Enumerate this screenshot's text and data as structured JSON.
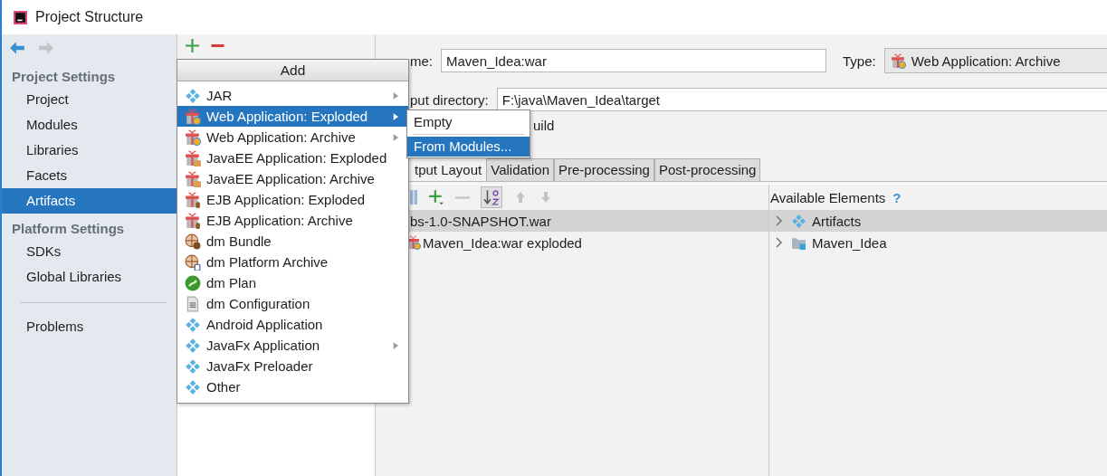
{
  "window": {
    "title": "Project Structure"
  },
  "sidebar": {
    "sections": [
      {
        "heading": "Project Settings",
        "items": [
          {
            "label": "Project",
            "selected": false
          },
          {
            "label": "Modules",
            "selected": false
          },
          {
            "label": "Libraries",
            "selected": false
          },
          {
            "label": "Facets",
            "selected": false
          },
          {
            "label": "Artifacts",
            "selected": true
          }
        ]
      },
      {
        "heading": "Platform Settings",
        "items": [
          {
            "label": "SDKs",
            "selected": false
          },
          {
            "label": "Global Libraries",
            "selected": false
          }
        ]
      }
    ],
    "footer_items": [
      {
        "label": "Problems",
        "selected": false
      }
    ]
  },
  "add_menu": {
    "title": "Add",
    "items": [
      {
        "label": "JAR",
        "kind": "diamond",
        "has_submenu": true,
        "selected": false
      },
      {
        "label": "Web Application: Exploded",
        "kind": "gift-web",
        "has_submenu": true,
        "selected": true
      },
      {
        "label": "Web Application: Archive",
        "kind": "gift-web",
        "has_submenu": true,
        "selected": false
      },
      {
        "label": "JavaEE Application: Exploded",
        "kind": "gift-ee",
        "has_submenu": false,
        "selected": false
      },
      {
        "label": "JavaEE Application: Archive",
        "kind": "gift-ee",
        "has_submenu": false,
        "selected": false
      },
      {
        "label": "EJB Application: Exploded",
        "kind": "gift-ejb",
        "has_submenu": false,
        "selected": false
      },
      {
        "label": "EJB Application: Archive",
        "kind": "gift-ejb",
        "has_submenu": false,
        "selected": false
      },
      {
        "label": "dm Bundle",
        "kind": "dm-bundle",
        "has_submenu": false,
        "selected": false
      },
      {
        "label": "dm Platform Archive",
        "kind": "dm-platform",
        "has_submenu": false,
        "selected": false
      },
      {
        "label": "dm Plan",
        "kind": "dm-plan",
        "has_submenu": false,
        "selected": false
      },
      {
        "label": "dm Configuration",
        "kind": "document",
        "has_submenu": false,
        "selected": false
      },
      {
        "label": "Android Application",
        "kind": "diamond",
        "has_submenu": false,
        "selected": false
      },
      {
        "label": "JavaFx Application",
        "kind": "diamond",
        "has_submenu": true,
        "selected": false
      },
      {
        "label": "JavaFx Preloader",
        "kind": "diamond",
        "has_submenu": false,
        "selected": false
      },
      {
        "label": "Other",
        "kind": "diamond",
        "has_submenu": false,
        "selected": false
      }
    ]
  },
  "submenu": {
    "items": [
      {
        "label": "Empty",
        "selected": false
      },
      {
        "label": "From Modules...",
        "selected": true
      }
    ]
  },
  "editor": {
    "name_label": "me:",
    "name_value": "Maven_Idea:war",
    "type_label": "Type:",
    "type_value": "Web Application: Archive",
    "output_label": "put directory:",
    "output_value": "F:\\java\\Maven_Idea\\target",
    "build_label": "uild",
    "tabs": [
      {
        "label": "tput Layout",
        "selected": true
      },
      {
        "label": "Validation",
        "selected": false
      },
      {
        "label": "Pre-processing",
        "selected": false
      },
      {
        "label": "Post-processing",
        "selected": false
      }
    ],
    "available_label": "Available Elements",
    "help": "?",
    "layout_tree": [
      {
        "label": "bs-1.0-SNAPSHOT.war",
        "selected": true,
        "children": [
          {
            "label": "Maven_Idea:war exploded",
            "selected": false
          }
        ]
      }
    ],
    "available_tree": [
      {
        "label": "Artifacts",
        "kind": "diamond",
        "selected": true,
        "expanded": false
      },
      {
        "label": "Maven_Idea",
        "kind": "folder",
        "selected": false,
        "expanded": false
      }
    ]
  }
}
